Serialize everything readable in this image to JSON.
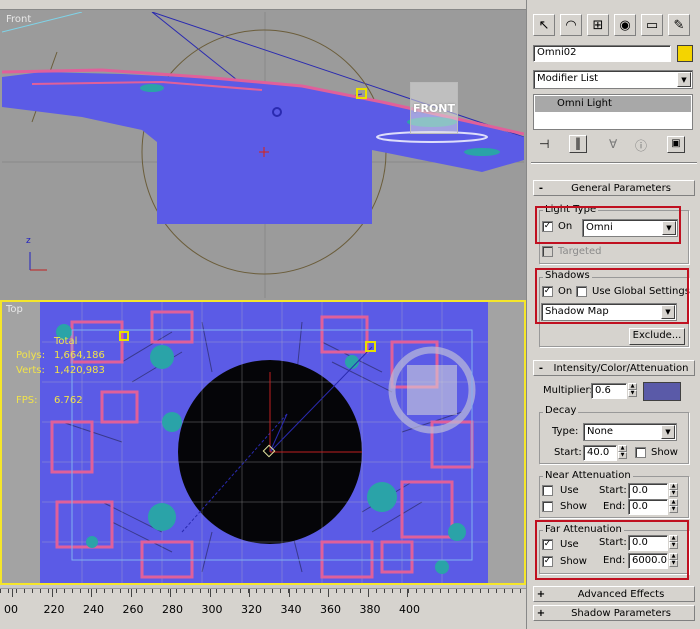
{
  "viewports": {
    "front": {
      "label": "Front",
      "view_cube_label": "FRONT"
    },
    "top": {
      "label": "Top",
      "stats": {
        "total_label": "Total",
        "polys_label": "Polys:",
        "polys_value": "1,664,186",
        "verts_label": "Verts:",
        "verts_value": "1,420,983",
        "fps_label": "FPS:",
        "fps_value": "6.762"
      }
    }
  },
  "ruler": {
    "ticks": [
      "00",
      "220",
      "240",
      "260",
      "280",
      "300",
      "320",
      "340",
      "360",
      "380",
      "400"
    ]
  },
  "command_panel": {
    "tabs": [
      {
        "name": "create-tab",
        "icon": "pointer-icon"
      },
      {
        "name": "modify-tab",
        "icon": "bend-icon"
      },
      {
        "name": "hierarchy-tab",
        "icon": "hierarchy-icon"
      },
      {
        "name": "motion-tab",
        "icon": "motion-icon"
      },
      {
        "name": "display-tab",
        "icon": "display-icon"
      },
      {
        "name": "utilities-tab",
        "icon": "utilities-icon"
      }
    ],
    "object_name": "Omni02",
    "object_color": "#f4d400",
    "modifier_list_label": "Modifier List",
    "stack_item": "Omni Light",
    "general_parameters": {
      "title": "General Parameters",
      "sign": "-",
      "light_type_label": "Light Type",
      "on_label": "On",
      "on_checked": true,
      "light_type_value": "Omni",
      "targeted_label": "Targeted",
      "shadows_label": "Shadows",
      "shadows_on_label": "On",
      "shadows_on_checked": true,
      "use_global_label": "Use Global Settings",
      "use_global_checked": false,
      "shadow_type_value": "Shadow Map",
      "exclude_label": "Exclude..."
    },
    "intensity": {
      "title": "Intensity/Color/Attenuation",
      "sign": "-",
      "multiplier_label": "Multiplier:",
      "multiplier_value": "0.6",
      "light_color": "#5a5aa8",
      "decay_label": "Decay",
      "decay_type_label": "Type:",
      "decay_type_value": "None",
      "decay_start_label": "Start:",
      "decay_start_value": "40.0",
      "decay_show_label": "Show",
      "near_atten_label": "Near Attenuation",
      "near_use_label": "Use",
      "near_show_label": "Show",
      "near_start_label": "Start:",
      "near_start_value": "0.0",
      "near_end_label": "End:",
      "near_end_value": "0.0",
      "far_atten_label": "Far Attenuation",
      "far_use_label": "Use",
      "far_use_checked": true,
      "far_show_label": "Show",
      "far_show_checked": true,
      "far_start_label": "Start:",
      "far_start_value": "0.0",
      "far_end_label": "End:",
      "far_end_value": "6000.0"
    },
    "collapsed_rollouts": [
      {
        "sign": "+",
        "title": "Advanced Effects"
      },
      {
        "sign": "+",
        "title": "Shadow Parameters"
      }
    ]
  },
  "colors": {
    "viewport_bg": "#9b9b9b",
    "mesh_blue": "#5b5be6",
    "mesh_pink": "#e0609a",
    "mesh_teal": "#2aa3a8",
    "active_border": "#f5e62a",
    "highlight_red": "#c01020"
  }
}
